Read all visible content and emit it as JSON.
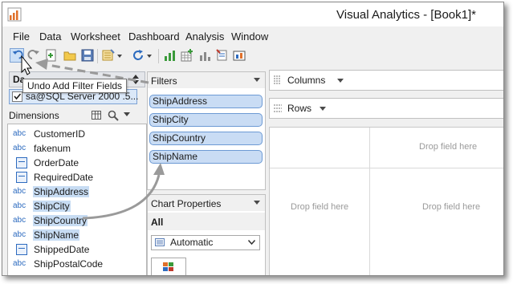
{
  "window": {
    "title": "Visual Analytics - [Book1]*"
  },
  "menu": [
    "File",
    "Data",
    "Worksheet",
    "Dashboard",
    "Analysis",
    "Window"
  ],
  "tooltip": "Undo Add Filter Fields",
  "data_pane": {
    "header": "Da",
    "datasource": "sa@SQL Server 2000 .5..."
  },
  "dimensions": {
    "header": "Dimensions",
    "items": [
      {
        "type": "abc",
        "name": "CustomerID"
      },
      {
        "type": "abc",
        "name": "fakenum"
      },
      {
        "type": "date",
        "name": "OrderDate"
      },
      {
        "type": "date",
        "name": "RequiredDate"
      },
      {
        "type": "abc",
        "name": "ShipAddress"
      },
      {
        "type": "abc",
        "name": "ShipCity"
      },
      {
        "type": "abc",
        "name": "ShipCountry"
      },
      {
        "type": "abc",
        "name": "ShipName"
      },
      {
        "type": "date",
        "name": "ShippedDate"
      },
      {
        "type": "abc",
        "name": "ShipPostalCode"
      }
    ]
  },
  "filters": {
    "header": "Filters",
    "pills": [
      "ShipAddress",
      "ShipCity",
      "ShipCountry",
      "ShipName"
    ]
  },
  "chart_properties": {
    "header": "Chart Properties",
    "scope": "All",
    "mark_type": "Automatic"
  },
  "shelves": {
    "columns": "Columns",
    "rows": "Rows"
  },
  "canvas": {
    "drop_top": "Drop field here",
    "drop_left": "Drop field here",
    "drop_center": "Drop field here"
  },
  "colors": {
    "accent_blue": "#2d6bbf",
    "pill_fill": "#c9dcf4",
    "selection": "#c7dcf3"
  }
}
